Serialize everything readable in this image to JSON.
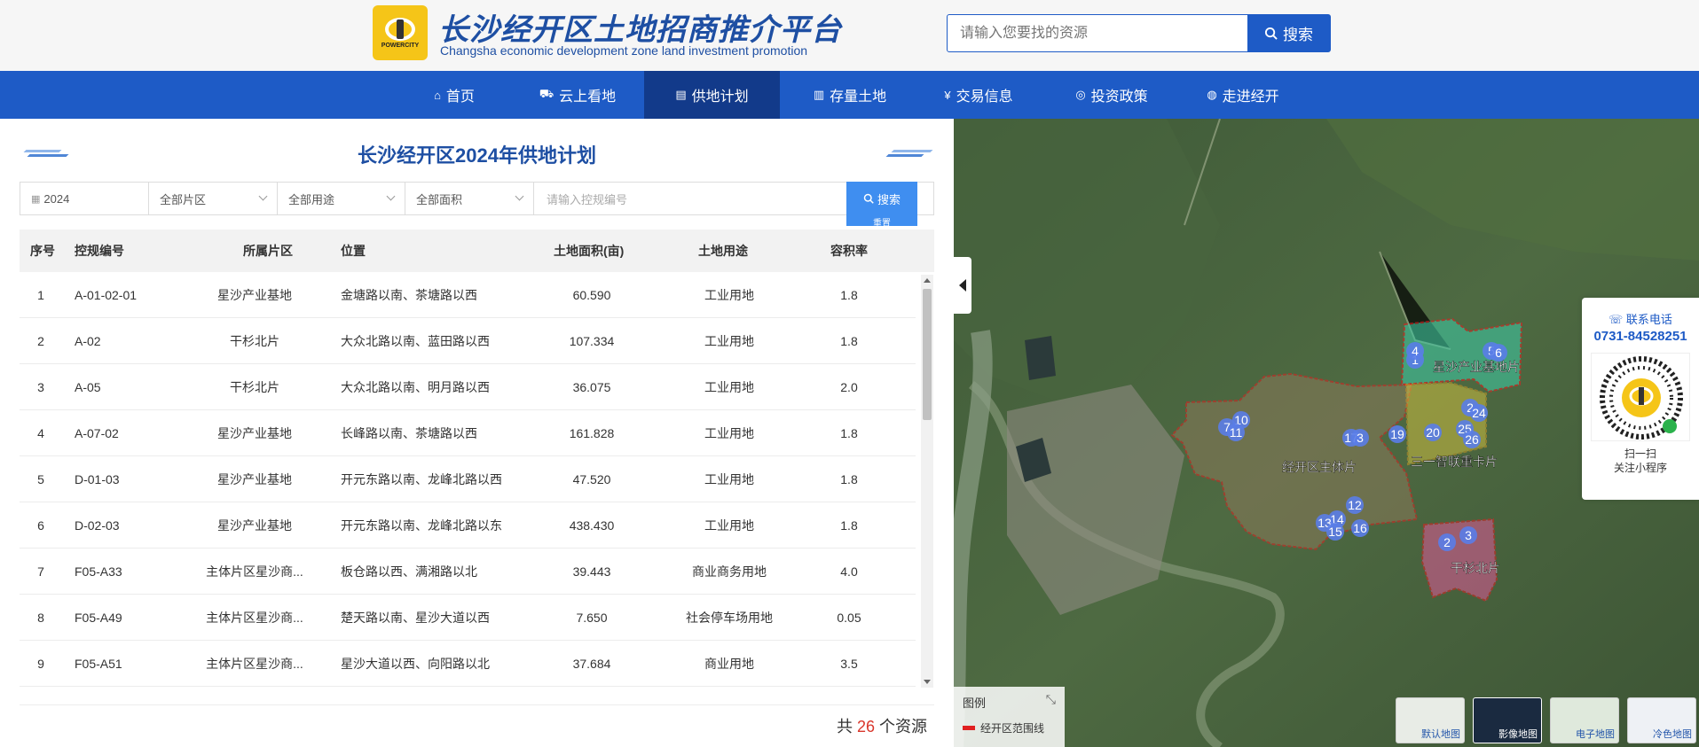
{
  "header": {
    "site_title": "长沙经开区土地招商推介平台",
    "site_subtitle": "Changsha economic development zone land investment promotion",
    "logo_brand": "POWERCITY",
    "search_placeholder": "请输入您要找的资源",
    "search_button": "搜索"
  },
  "nav": {
    "items": [
      {
        "label": "首页",
        "icon": "home-icon"
      },
      {
        "label": "云上看地",
        "icon": "car-icon"
      },
      {
        "label": "供地计划",
        "icon": "plan-icon",
        "active": true
      },
      {
        "label": "存量土地",
        "icon": "building-icon"
      },
      {
        "label": "交易信息",
        "icon": "yen-icon"
      },
      {
        "label": "投资政策",
        "icon": "policy-icon"
      },
      {
        "label": "走进经开",
        "icon": "globe-icon"
      }
    ]
  },
  "panel": {
    "title": "长沙经开区2024年供地计划",
    "filters": {
      "year": "2024",
      "district": "全部片区",
      "usage": "全部用途",
      "area": "全部面积",
      "code_placeholder": "请输入控规编号",
      "search_button": "搜索",
      "reset_button": "重置"
    },
    "columns": [
      "序号",
      "控规编号",
      "所属片区",
      "位置",
      "土地面积(亩)",
      "土地用途",
      "容积率"
    ],
    "rows": [
      [
        "1",
        "A-01-02-01",
        "星沙产业基地",
        "金塘路以南、茶塘路以西",
        "60.590",
        "工业用地",
        "1.8"
      ],
      [
        "2",
        "A-02",
        "干杉北片",
        "大众北路以南、蓝田路以西",
        "107.334",
        "工业用地",
        "1.8"
      ],
      [
        "3",
        "A-05",
        "干杉北片",
        "大众北路以南、明月路以西",
        "36.075",
        "工业用地",
        "2.0"
      ],
      [
        "4",
        "A-07-02",
        "星沙产业基地",
        "长峰路以南、茶塘路以西",
        "161.828",
        "工业用地",
        "1.8"
      ],
      [
        "5",
        "D-01-03",
        "星沙产业基地",
        "开元东路以南、龙峰北路以西",
        "47.520",
        "工业用地",
        "1.8"
      ],
      [
        "6",
        "D-02-03",
        "星沙产业基地",
        "开元东路以南、龙峰北路以东",
        "438.430",
        "工业用地",
        "1.8"
      ],
      [
        "7",
        "F05-A33",
        "主体片区星沙商...",
        "板仓路以西、满湘路以北",
        "39.443",
        "商业商务用地",
        "4.0"
      ],
      [
        "8",
        "F05-A49",
        "主体片区星沙商...",
        "楚天路以南、星沙大道以西",
        "7.650",
        "社会停车场用地",
        "0.05"
      ],
      [
        "9",
        "F05-A51",
        "主体片区星沙商...",
        "星沙大道以西、向阳路以北",
        "37.684",
        "商业用地",
        "3.5"
      ]
    ],
    "total_prefix": "共",
    "total_count": "26",
    "total_suffix": "个资源"
  },
  "map": {
    "zones": [
      "星沙产业基地片",
      "经开区主体片",
      "三一智联重卡片",
      "干杉北片"
    ],
    "markers": [
      "1",
      "4",
      "5",
      "6",
      "7",
      "10",
      "11",
      "17",
      "3",
      "19",
      "20",
      "2",
      "25",
      "24",
      "26",
      "12",
      "14",
      "13",
      "15",
      "16",
      "2",
      "3"
    ],
    "contact_label": "联系电话",
    "contact_phone": "0731-84528251",
    "scan_line1": "扫一扫",
    "scan_line2": "关注小程序",
    "legend_title": "图例",
    "legend_item": "经开区范围线",
    "tiles": [
      "默认地图",
      "影像地图",
      "电子地图",
      "冷色地图"
    ],
    "colors": {
      "boundary": "#e02020",
      "zone_green": "#3fc6a0",
      "zone_pink": "#e05a9a",
      "zone_yellow": "#e8d040",
      "marker": "#5a7de8"
    }
  }
}
